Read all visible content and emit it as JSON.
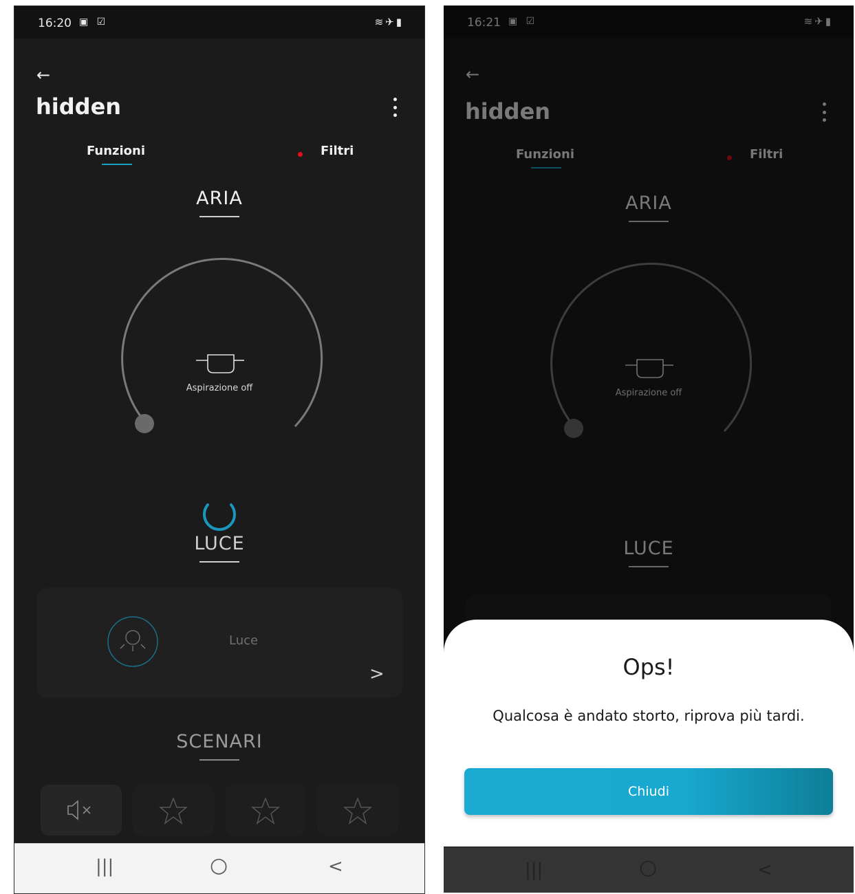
{
  "screens": [
    {
      "status": {
        "time": "16:20"
      },
      "header": {
        "back": "←",
        "title": "hidden"
      },
      "tabs": {
        "funzioni": "Funzioni",
        "filtri": "Filtri"
      },
      "aria": {
        "heading": "ARIA",
        "dial_label": "Aspirazione off"
      },
      "luce": {
        "heading": "LUCE",
        "card_label": "Luce",
        "chevron": ">"
      },
      "scenari": {
        "heading": "SCENARI"
      },
      "nav": {
        "recent": "|||",
        "home": "○",
        "back": "<"
      }
    },
    {
      "status": {
        "time": "16:21"
      },
      "header": {
        "back": "←",
        "title": "hidden"
      },
      "tabs": {
        "funzioni": "Funzioni",
        "filtri": "Filtri"
      },
      "aria": {
        "heading": "ARIA",
        "dial_label": "Aspirazione off"
      },
      "luce": {
        "heading": "LUCE"
      },
      "dialog": {
        "title": "Ops!",
        "message": "Qualcosa è andato storto, riprova più tardi.",
        "button": "Chiudi"
      },
      "nav": {
        "recent": "|||",
        "home": "○",
        "back": "<"
      }
    }
  ],
  "colors": {
    "accent": "#17a2c4",
    "alert_dot": "#e0101a",
    "background": "#1b1b1b"
  },
  "icons": [
    "arrow-left-icon",
    "more-vert-icon",
    "pot-icon",
    "bulb-icon",
    "chevron-right-icon",
    "mute-icon",
    "star-icon",
    "spinner-icon",
    "wifi-icon",
    "airplane-icon",
    "battery-icon"
  ]
}
